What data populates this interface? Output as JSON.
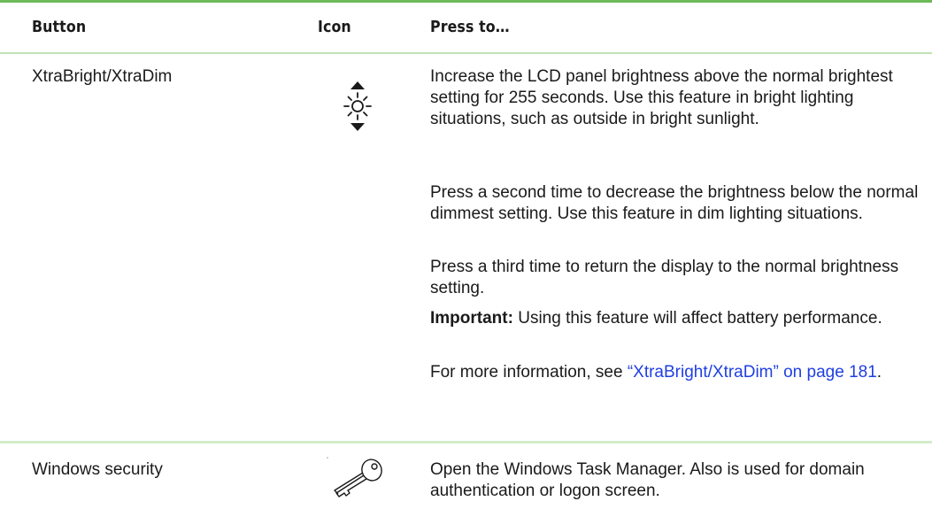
{
  "table": {
    "headers": {
      "button": "Button",
      "icon": "Icon",
      "press_to": "Press to…"
    },
    "rows": [
      {
        "button": "XtraBright/XtraDim",
        "icon": "brightness-up-down-icon",
        "desc_1": "Increase the LCD panel brightness above the normal brightest setting for 255 seconds. Use this feature in bright lighting situations, such as outside in bright sunlight.",
        "desc_2": "Press a second time to decrease the brightness below the normal dimmest setting. Use this feature in dim lighting situations.",
        "desc_3": "Press a third time to return the display to the normal brightness setting.",
        "important_label": "Important:",
        "important_text": " Using this feature will affect battery performance.",
        "more_info_prefix": "For more information, see ",
        "more_info_link": "“XtraBright/XtraDim” on page 181",
        "more_info_suffix": "."
      },
      {
        "button": "Windows security",
        "icon": "key-icon",
        "desc_1": "Open the Windows Task Manager. Also is used for domain authentication or logon screen."
      }
    ]
  },
  "colors": {
    "rule_top": "#6cba5a",
    "rule_light": "#d3ecca",
    "link": "#1f3fe0"
  }
}
